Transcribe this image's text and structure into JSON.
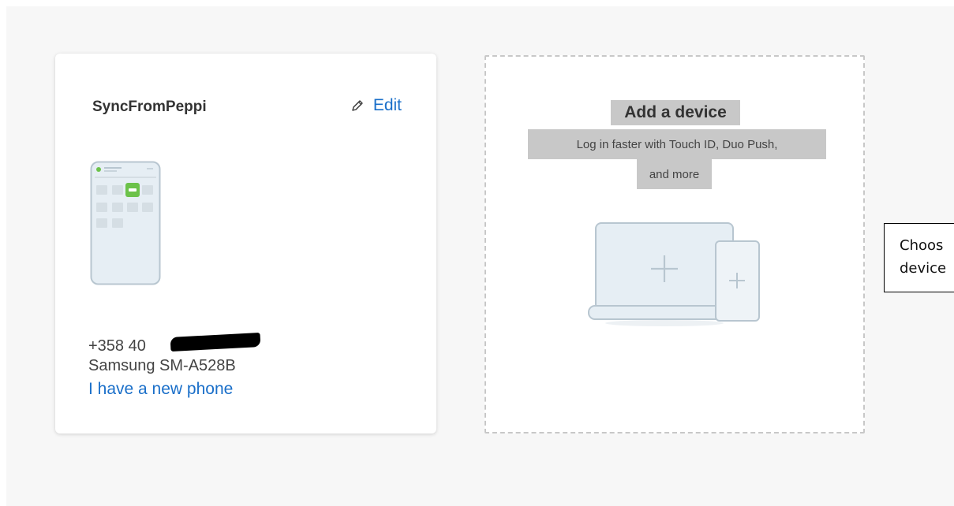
{
  "device": {
    "name": "SyncFromPeppi",
    "edit_label": "Edit",
    "phone_number_prefix": "+358 40",
    "model": "Samsung SM-A528B",
    "new_phone_link": "I have a new phone",
    "icons": [
      "pencil-icon",
      "phone-illustration"
    ]
  },
  "add_device": {
    "title": "Add a device",
    "description_line1": "Log in faster with Touch ID, Duo Push,",
    "description_line2": "and more",
    "icons": [
      "laptop-phone-plus-illustration"
    ]
  },
  "annotation": {
    "line1": "Choos",
    "line2": "device"
  },
  "colors": {
    "link": "#1a6fc9",
    "duo_green": "#6cc24a",
    "highlight": "#c8c8c8",
    "illustration_fill": "#e6eef4",
    "illustration_stroke": "#b8c6d0"
  }
}
